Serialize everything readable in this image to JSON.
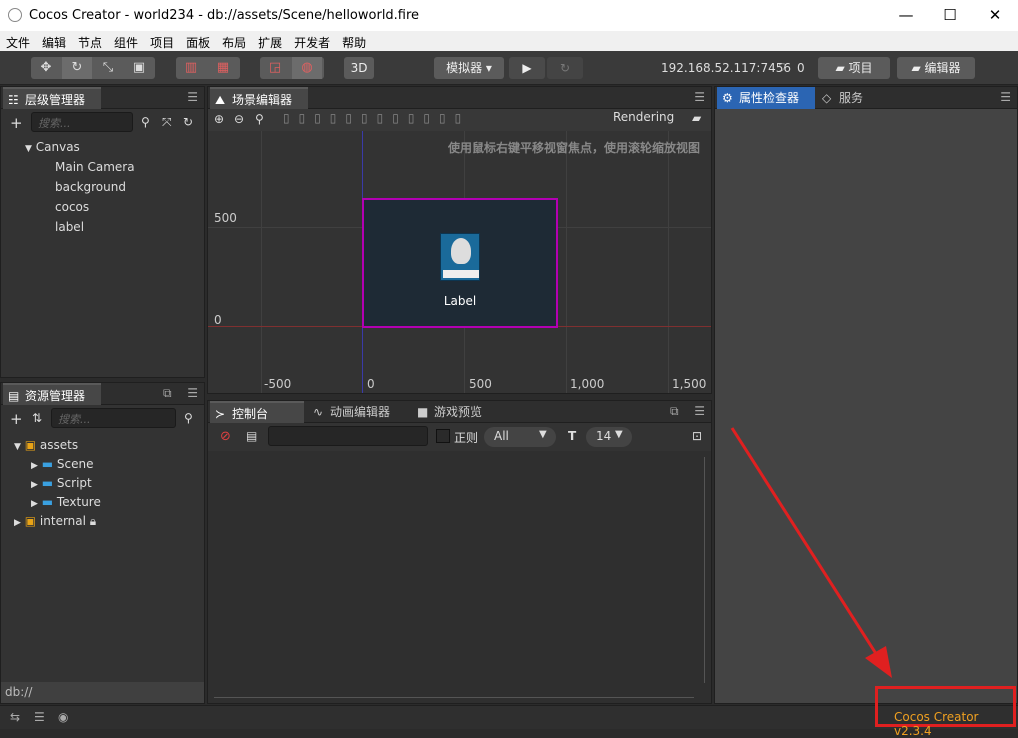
{
  "window": {
    "title": "Cocos Creator - world234 - db://assets/Scene/helloworld.fire"
  },
  "menu": [
    "文件",
    "编辑",
    "节点",
    "组件",
    "项目",
    "面板",
    "布局",
    "扩展",
    "开发者",
    "帮助"
  ],
  "toolbar": {
    "btn3d": "3D",
    "simulator": "模拟器 ▾",
    "ip": "192.168.52.117:7456",
    "wifi_count": "0",
    "project_btn": "项目",
    "editor_btn": "编辑器"
  },
  "hierarchy": {
    "tab": "层级管理器",
    "search_placeholder": "搜索...",
    "root": "Canvas",
    "items": [
      "Main Camera",
      "background",
      "cocos",
      "label"
    ]
  },
  "assets": {
    "tab": "资源管理器",
    "search_placeholder": "搜索...",
    "root": "assets",
    "items": [
      "Scene",
      "Script",
      "Texture"
    ],
    "internal": "internal",
    "footer": "db://"
  },
  "scene": {
    "tab": "场景编辑器",
    "rendering": "Rendering",
    "hint": "使用鼠标右键平移视窗焦点，使用滚轮缩放视图",
    "canvas_label": "Label",
    "y_ticks": [
      "500",
      "0"
    ],
    "x_ticks": [
      "-500",
      "0",
      "500",
      "1,000",
      "1,500"
    ]
  },
  "console": {
    "tabs": [
      "控制台",
      "动画编辑器",
      "游戏预览"
    ],
    "regex_label": "正则",
    "level": "All",
    "font_size": "14"
  },
  "inspector": {
    "tabs": [
      "属性检查器",
      "服务"
    ]
  },
  "status": {
    "version": "Cocos Creator v2.3.4"
  },
  "colors": {
    "accent": "#2b65b3",
    "highlight": "#e02020",
    "canvas_border": "#b300b3"
  }
}
